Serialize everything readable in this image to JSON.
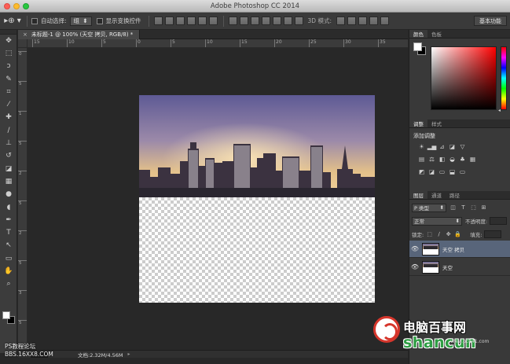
{
  "window": {
    "title": "Adobe Photoshop CC 2014"
  },
  "options_bar": {
    "tool_glyph": "▸⊕ ▾",
    "auto_select_label": "自动选择:",
    "auto_select_value": "组",
    "show_transform_label": "显示变换控件",
    "mode_3d_label": "3D 模式:",
    "workspace_label": "基本功能"
  },
  "tools": {
    "icons": [
      {
        "name": "move-tool-icon",
        "glyph": "✥"
      },
      {
        "name": "marquee-tool-icon",
        "glyph": "⬚"
      },
      {
        "name": "lasso-tool-icon",
        "glyph": "ↄ"
      },
      {
        "name": "quick-select-tool-icon",
        "glyph": "✎"
      },
      {
        "name": "crop-tool-icon",
        "glyph": "⌗"
      },
      {
        "name": "eyedropper-tool-icon",
        "glyph": "⁄"
      },
      {
        "name": "healing-brush-tool-icon",
        "glyph": "✚"
      },
      {
        "name": "brush-tool-icon",
        "glyph": "∕"
      },
      {
        "name": "stamp-tool-icon",
        "glyph": "⊥"
      },
      {
        "name": "history-brush-tool-icon",
        "glyph": "↺"
      },
      {
        "name": "eraser-tool-icon",
        "glyph": "◪"
      },
      {
        "name": "gradient-tool-icon",
        "glyph": "▦"
      },
      {
        "name": "blur-tool-icon",
        "glyph": "●"
      },
      {
        "name": "dodge-tool-icon",
        "glyph": "◖"
      },
      {
        "name": "pen-tool-icon",
        "glyph": "✒"
      },
      {
        "name": "type-tool-icon",
        "glyph": "T"
      },
      {
        "name": "path-select-tool-icon",
        "glyph": "↖"
      },
      {
        "name": "shape-tool-icon",
        "glyph": "▭"
      },
      {
        "name": "hand-tool-icon",
        "glyph": "✋"
      },
      {
        "name": "zoom-tool-icon",
        "glyph": "⌕"
      }
    ],
    "foreground_color": "#ffffff",
    "background_color": "#000000"
  },
  "document": {
    "tab_title": "未标题-1 @ 100% (天空 拷贝, RGB/8) *",
    "close_glyph": "×",
    "ruler_h_labels": [
      "15",
      "10",
      "5",
      "0",
      "5",
      "10",
      "15",
      "20",
      "25",
      "30",
      "35",
      "40"
    ],
    "ruler_v_labels": [
      "0",
      "5",
      "1",
      "5",
      "2",
      "5",
      "2",
      "5",
      "3",
      "5"
    ],
    "status_doc_size": "文档:2.32M/4.56M",
    "status_arrow": "▸"
  },
  "panels": {
    "color_tabs": [
      "颜色",
      "色板"
    ],
    "adjust_tabs": [
      "调整",
      "样式"
    ],
    "adjust_title": "添加调整",
    "adjust_row1": [
      "☀",
      "▂▅",
      "⊿",
      "◪",
      "▽"
    ],
    "adjust_row2": [
      "▤",
      "⚖",
      "◧",
      "◒",
      "♣",
      "▦"
    ],
    "adjust_row3": [
      "◩",
      "◪",
      "▭",
      "⬓",
      "▭"
    ],
    "layers_tabs": [
      "图层",
      "通道",
      "路径"
    ],
    "kind_filter": "Ρ 类型",
    "filter_icons": [
      "◫",
      "T",
      "⬚",
      "⊞"
    ],
    "blend_mode": "正常",
    "opacity_label": "不透明度:",
    "lock_label": "锁定:",
    "lock_icons": [
      "⬚",
      "∕",
      "✥",
      "🔒"
    ],
    "fill_label": "填充:",
    "layers": [
      {
        "name": "天空 拷贝",
        "selected": true,
        "visible_glyph": "👁"
      },
      {
        "name": "天空",
        "selected": false,
        "visible_glyph": "👁"
      }
    ]
  },
  "watermarks": {
    "left_line1": "PS教程论坛",
    "left_line2": "BBS.16XX8.COM",
    "brand_cn": "电脑百事网",
    "brand_en": "shancun",
    "brand_url": "www.pc841.com"
  },
  "colors": {
    "selected_layer": "#58657a",
    "brand_red": "#d6362c",
    "brand_green": "#2f9e44"
  }
}
